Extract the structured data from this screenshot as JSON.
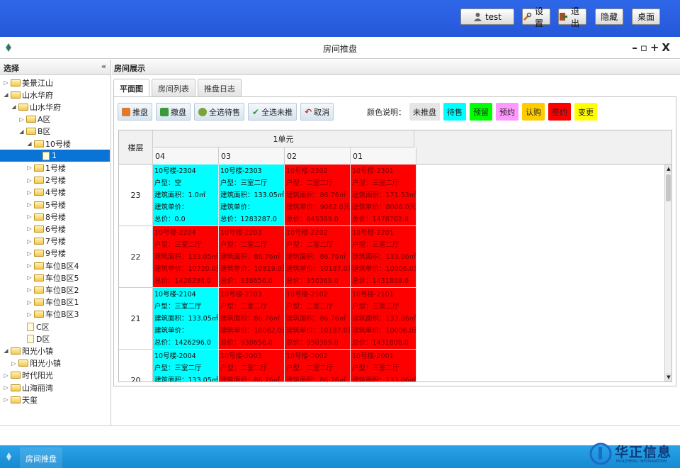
{
  "topbar": {
    "buttons": [
      {
        "label": "test",
        "icon": "user-icon"
      },
      {
        "label": "设置",
        "icon": "settings-icon"
      },
      {
        "label": "退出",
        "icon": "exit-icon"
      },
      {
        "label": "隐藏",
        "icon": ""
      },
      {
        "label": "桌面",
        "icon": ""
      }
    ]
  },
  "window": {
    "title": "房间推盘",
    "controls": "–▫+X"
  },
  "sidebar": {
    "header": "选择",
    "collapse": "«",
    "tree": [
      {
        "label": "美景江山",
        "level": 0,
        "toggle": "▷",
        "icon": "folder"
      },
      {
        "label": "山水华府",
        "level": 0,
        "toggle": "◢",
        "icon": "folder"
      },
      {
        "label": "山水华府",
        "level": 1,
        "toggle": "◢",
        "icon": "folder"
      },
      {
        "label": "A区",
        "level": 2,
        "toggle": "▷",
        "icon": "folder"
      },
      {
        "label": "B区",
        "level": 2,
        "toggle": "◢",
        "icon": "folder"
      },
      {
        "label": "10号楼",
        "level": 3,
        "toggle": "◢",
        "icon": "folder"
      },
      {
        "label": "1",
        "level": 4,
        "toggle": "",
        "icon": "doc",
        "selected": true
      },
      {
        "label": "1号楼",
        "level": 3,
        "toggle": "▷",
        "icon": "folder"
      },
      {
        "label": "2号楼",
        "level": 3,
        "toggle": "▷",
        "icon": "folder"
      },
      {
        "label": "4号楼",
        "level": 3,
        "toggle": "▷",
        "icon": "folder"
      },
      {
        "label": "5号楼",
        "level": 3,
        "toggle": "▷",
        "icon": "folder"
      },
      {
        "label": "8号楼",
        "level": 3,
        "toggle": "▷",
        "icon": "folder"
      },
      {
        "label": "6号楼",
        "level": 3,
        "toggle": "▷",
        "icon": "folder"
      },
      {
        "label": "7号楼",
        "level": 3,
        "toggle": "▷",
        "icon": "folder"
      },
      {
        "label": "9号楼",
        "level": 3,
        "toggle": "▷",
        "icon": "folder"
      },
      {
        "label": "车位B区4",
        "level": 3,
        "toggle": "▷",
        "icon": "folder"
      },
      {
        "label": "车位B区5",
        "level": 3,
        "toggle": "▷",
        "icon": "folder"
      },
      {
        "label": "车位B区2",
        "level": 3,
        "toggle": "▷",
        "icon": "folder"
      },
      {
        "label": "车位B区1",
        "level": 3,
        "toggle": "▷",
        "icon": "folder"
      },
      {
        "label": "车位B区3",
        "level": 3,
        "toggle": "▷",
        "icon": "folder"
      },
      {
        "label": "C区",
        "level": 2,
        "toggle": "",
        "icon": "doc"
      },
      {
        "label": "D区",
        "level": 2,
        "toggle": "",
        "icon": "doc"
      },
      {
        "label": "阳光小镇",
        "level": 0,
        "toggle": "◢",
        "icon": "folder"
      },
      {
        "label": "阳光小镇",
        "level": 1,
        "toggle": "▷",
        "icon": "folder"
      },
      {
        "label": "时代阳光",
        "level": 0,
        "toggle": "▷",
        "icon": "folder"
      },
      {
        "label": "山海丽湾",
        "level": 0,
        "toggle": "▷",
        "icon": "folder"
      },
      {
        "label": "天玺",
        "level": 0,
        "toggle": "▷",
        "icon": "folder"
      }
    ]
  },
  "main": {
    "header": "房间展示",
    "tabs": [
      {
        "label": "平面图",
        "active": true
      },
      {
        "label": "房间列表",
        "active": false
      },
      {
        "label": "推盘日志",
        "active": false
      }
    ],
    "toolbar": [
      {
        "label": "推盘",
        "color": "#e07a2a"
      },
      {
        "label": "撤盘",
        "color": "#3a9a3a"
      },
      {
        "label": "全选待售",
        "color": "#7aa33a"
      },
      {
        "label": "全选未推",
        "color": "#2a9a2a"
      },
      {
        "label": "取消",
        "color": "#c0392b"
      }
    ],
    "legend_label": "颜色说明：",
    "legend": [
      {
        "label": "未推盘",
        "color": "#e6e6e6"
      },
      {
        "label": "待售",
        "color": "#00ffff"
      },
      {
        "label": "预留",
        "color": "#00ff00"
      },
      {
        "label": "预约",
        "color": "#ff99ff"
      },
      {
        "label": "认购",
        "color": "#ffcc00"
      },
      {
        "label": "签约",
        "color": "#ff0000"
      },
      {
        "label": "变更",
        "color": "#ffff00"
      }
    ],
    "grid": {
      "floor_header": "楼层",
      "unit_header": "1单元",
      "columns": [
        "04",
        "03",
        "02",
        "01"
      ],
      "rows": [
        {
          "floor": "23",
          "cells": [
            {
              "status": "cyan",
              "lines": [
                "10号楼-2304",
                "户型：空",
                "建筑面积：1.0㎡",
                "建筑单价：",
                "总价：0.0"
              ]
            },
            {
              "status": "cyan",
              "lines": [
                "10号楼-2303",
                "户型：三室二厅",
                "建筑面积：133.05㎡",
                "建筑单价：",
                "总价：1283287.0"
              ]
            },
            {
              "status": "red",
              "lines": [
                "10号楼-2302",
                "户型：二室二厅",
                "建筑面积：86.76㎡",
                "建筑单价：9062.0元",
                "总价：845389.0"
              ]
            },
            {
              "status": "red",
              "lines": [
                "10号楼-2301",
                "户型：三室二厅",
                "建筑面积：171.53㎡",
                "建筑单价：8006.0元",
                "总价：1478702.0"
              ]
            }
          ]
        },
        {
          "floor": "22",
          "cells": [
            {
              "status": "red",
              "lines": [
                "10号楼-2204",
                "户型：三室二厅",
                "建筑面积：133.05㎡",
                "建筑单价：10720.0元",
                "总价：1426296.0"
              ]
            },
            {
              "status": "red",
              "lines": [
                "10号楼-2203",
                "户型：二室二厅",
                "建筑面积：86.76㎡",
                "建筑单价：10819.0元",
                "总价：938656.0"
              ]
            },
            {
              "status": "red",
              "lines": [
                "10号楼-2202",
                "户型：二室二厅",
                "建筑面积：86.76㎡",
                "建筑单价：10187.0元",
                "总价：950369.0"
              ]
            },
            {
              "status": "red",
              "lines": [
                "10号楼-2201",
                "户型：三室二厅",
                "建筑面积：133.06㎡",
                "建筑单价：10006.0元",
                "总价：1431808.0"
              ]
            }
          ]
        },
        {
          "floor": "21",
          "cells": [
            {
              "status": "cyan",
              "lines": [
                "10号楼-2104",
                "户型：三室二厅",
                "建筑面积：133.05㎡",
                "建筑单价：",
                "总价：1426296.0"
              ]
            },
            {
              "status": "red",
              "lines": [
                "10号楼-2103",
                "户型：二室二厅",
                "建筑面积：86.76㎡",
                "建筑单价：10062.0元",
                "总价：938656.0"
              ]
            },
            {
              "status": "red",
              "lines": [
                "10号楼-2102",
                "户型：二室二厅",
                "建筑面积：86.76㎡",
                "建筑单价：10187.0元",
                "总价：950369.0"
              ]
            },
            {
              "status": "red",
              "lines": [
                "10号楼-2101",
                "户型：三室二厅",
                "建筑面积：133.06㎡",
                "建筑单价：10006.0元",
                "总价：1431808.0"
              ]
            }
          ]
        },
        {
          "floor": "20",
          "cells": [
            {
              "status": "cyan",
              "lines": [
                "10号楼-2004",
                "户型：三室二厅",
                "建筑面积：133.05㎡"
              ]
            },
            {
              "status": "red",
              "lines": [
                "10号楼-2003",
                "户型：二室二厅",
                "建筑面积：86.76㎡"
              ]
            },
            {
              "status": "red",
              "lines": [
                "10号楼-2002",
                "户型：二室二厅",
                "建筑面积：86.76㎡"
              ]
            },
            {
              "status": "red",
              "lines": [
                "10号楼-2001",
                "户型：三室二厅",
                "建筑面积：133.06㎡"
              ]
            }
          ]
        }
      ]
    }
  },
  "taskbar": {
    "item": "房间推盘"
  },
  "brand": {
    "name_cn": "华正信息",
    "name_en": "HUAZHENG INFORMATION"
  }
}
